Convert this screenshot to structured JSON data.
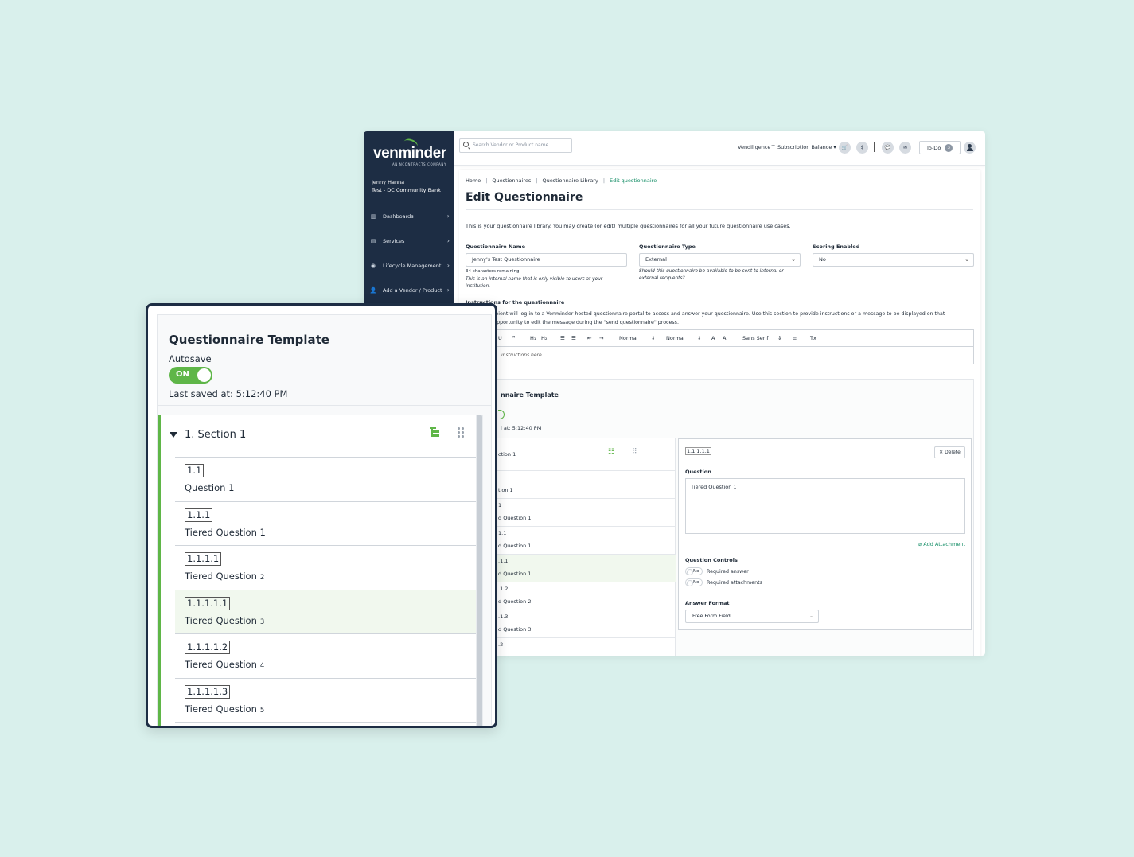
{
  "app": {
    "logo": {
      "word": "venminder",
      "sub": "AN NCONTRACTS COMPANY"
    },
    "user": {
      "name": "Jenny Hanna",
      "org": "Test - DC Community Bank"
    },
    "nav": [
      {
        "label": "Dashboards",
        "icon": "chart-icon"
      },
      {
        "label": "Services",
        "icon": "document-icon"
      },
      {
        "label": "Lifecycle Management",
        "icon": "cycle-icon"
      },
      {
        "label": "Add a Vendor / Product",
        "icon": "add-user-icon"
      }
    ],
    "topbar": {
      "search_placeholder": "Search Vendor or Product name",
      "balance": "Vendiligence™ Subscription Balance ▾",
      "cart": "🛒",
      "dollar": "$",
      "chat": "💬",
      "mail": "✉",
      "todo_label": "To-Do",
      "todo_count": "3"
    },
    "breadcrumbs": [
      "Home",
      "Questionnaires",
      "Questionnaire Library",
      "Edit questionnaire"
    ],
    "page_title": "Edit Questionnaire",
    "intro": "This is your questionnaire library. You may create (or edit) multiple questionnaires for all your future questionnaire use cases.",
    "fields": {
      "name_label": "Questionnaire Name",
      "name_value": "Jenny's Test Questionnaire",
      "name_count": "34 characters remaining",
      "name_help": "This is an internal name that is only visible to users at your institution.",
      "type_label": "Questionnaire Type",
      "type_value": "External",
      "type_help": "Should this questionnaire be available to be sent to internal or external recipients?",
      "scoring_label": "Scoring Enabled",
      "scoring_value": "No"
    },
    "instructions": {
      "label": "Instructions for the questionnaire",
      "line1": "onnaire recipient will log in to a Venminder hosted questionnaire portal to access and answer your questionnaire. Use this section to provide instructions or a message to be displayed on that",
      "line2": "ll have the opportunity to edit the message during the \"send questionnaire\" process.",
      "placeholder": "instructions here",
      "toolbar": {
        "heading1": "H₁",
        "heading2": "H₂",
        "size1": "Normal",
        "size2": "Normal",
        "font": "Sans Serif",
        "quote": "❞",
        "clear": "Tx"
      }
    },
    "template": {
      "title": "nnaire Template",
      "saved": "l at: 5:12:40 PM",
      "tree": [
        {
          "label": "ction 1"
        },
        {
          "label": "tion 1"
        },
        {
          "label": "d Question 1"
        },
        {
          "label": "d Question 1"
        },
        {
          "label": "d Question 1"
        },
        {
          "label": "d Question 2"
        },
        {
          "label": "d Question 3"
        }
      ],
      "tree_nums": [
        "1",
        "1.1",
        ".1.1",
        ".1.2",
        ".1.3",
        ".2"
      ],
      "detail": {
        "number": "1.1.1.1.1",
        "delete": "✕ Delete",
        "question_label": "Question",
        "question_value": "Tiered Question 1",
        "attachment": "Add Attachment",
        "controls_label": "Question Controls",
        "toggle_off": "No",
        "required_answer": "Required answer",
        "required_attachments": "Required attachments",
        "format_label": "Answer Format",
        "format_value": "Free Form Field"
      }
    }
  },
  "card": {
    "title": "Questionnaire Template",
    "autosave_label": "Autosave",
    "autosave_state": "ON",
    "last_saved": "Last saved at: 5:12:40 PM",
    "section": {
      "title": "1.  Section 1"
    },
    "rows": [
      {
        "num": "1.1",
        "text": "Question 1",
        "idx": ""
      },
      {
        "num": "1.1.1",
        "text": "Tiered Question 1",
        "idx": ""
      },
      {
        "num": "1.1.1.1",
        "text": "Tiered Question",
        "idx": "2"
      },
      {
        "num": "1.1.1.1.1",
        "text": "Tiered Question",
        "idx": "3",
        "highlighted": true
      },
      {
        "num": "1.1.1.1.2",
        "text": "Tiered Question",
        "idx": "4"
      },
      {
        "num": "1.1.1.1.3",
        "text": "Tiered Question",
        "idx": "5"
      }
    ]
  },
  "colors": {
    "navy": "#1d2d44",
    "green": "#5fb648",
    "teal_bg": "#d9f0ec",
    "link": "#0f8b63"
  }
}
